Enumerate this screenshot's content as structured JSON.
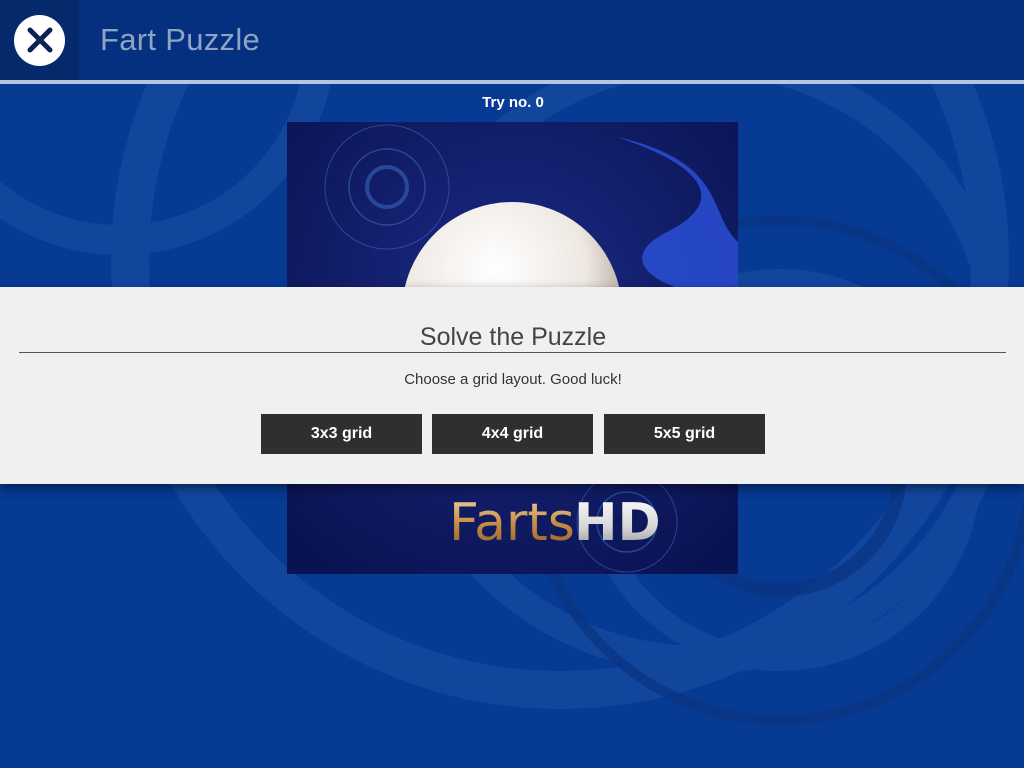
{
  "header": {
    "title": "Fart Puzzle",
    "close_icon": "close-icon"
  },
  "status": {
    "try_label": "Try no. 0"
  },
  "puzzle_image": {
    "logo_word": "Farts",
    "logo_suffix": "HD"
  },
  "modal": {
    "title": "Solve the Puzzle",
    "message": "Choose a grid layout. Good luck!",
    "buttons": [
      {
        "label": "3x3 grid"
      },
      {
        "label": "4x4 grid"
      },
      {
        "label": "5x5 grid"
      }
    ]
  },
  "colors": {
    "background": "#063a93",
    "header": "#05307f",
    "modal": "#f0f0f0",
    "button": "#2f2f2f"
  }
}
